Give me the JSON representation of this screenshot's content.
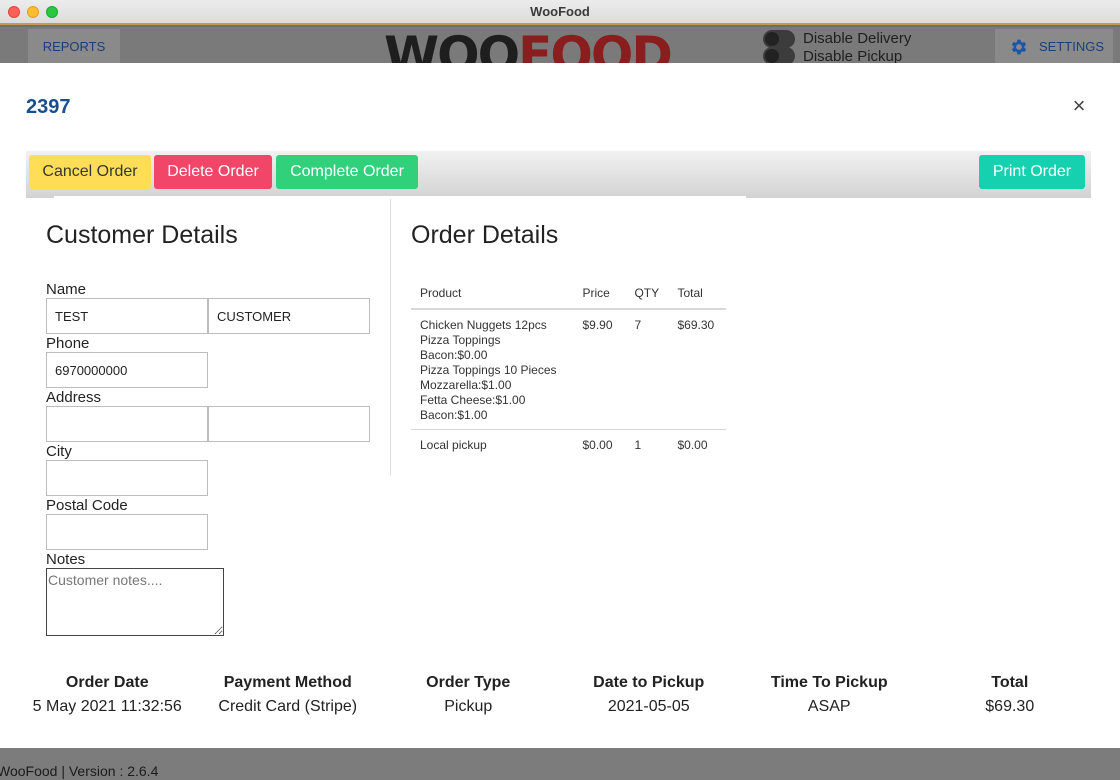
{
  "window": {
    "title": "WooFood"
  },
  "header": {
    "reports_label": "REPORTS",
    "brand_part1": "WOO",
    "brand_part2": "FOOD",
    "toggle_delivery_label": "Disable Delivery",
    "toggle_pickup_label": "Disable Pickup",
    "settings_label": "SETTINGS"
  },
  "modal": {
    "order_id": "2397",
    "close_icon": "×",
    "actions": {
      "cancel": "Cancel Order",
      "delete": "Delete Order",
      "complete": "Complete Order",
      "print": "Print Order"
    },
    "customer": {
      "title": "Customer Details",
      "name_label": "Name",
      "first_name": "TEST",
      "last_name": "CUSTOMER",
      "phone_label": "Phone",
      "phone": "6970000000",
      "address_label": "Address",
      "address_1": "",
      "address_2": "",
      "city_label": "City",
      "city": "",
      "postal_label": "Postal Code",
      "postal": "",
      "notes_label": "Notes",
      "notes_placeholder": "Customer notes...."
    },
    "order": {
      "title": "Order Details",
      "columns": [
        "Product",
        "Price",
        "QTY",
        "Total"
      ],
      "rows": [
        {
          "product_lines": [
            "Chicken Nuggets 12pcs",
            "Pizza Toppings",
            "Bacon:$0.00",
            "Pizza Toppings 10 Pieces",
            "Mozzarella:$1.00",
            "Fetta Cheese:$1.00",
            "Bacon:$1.00"
          ],
          "price": "$9.90",
          "qty": "7",
          "total": "$69.30"
        },
        {
          "product_lines": [
            "Local pickup"
          ],
          "price": "$0.00",
          "qty": "1",
          "total": "$0.00"
        }
      ]
    },
    "summary": [
      {
        "label": "Order Date",
        "value": "5 May 2021 11:32:56"
      },
      {
        "label": "Payment Method",
        "value": "Credit Card (Stripe)"
      },
      {
        "label": "Order Type",
        "value": "Pickup"
      },
      {
        "label": "Date to Pickup",
        "value": "2021-05-05"
      },
      {
        "label": "Time To Pickup",
        "value": "ASAP"
      },
      {
        "label": "Total",
        "value": "$69.30"
      }
    ]
  },
  "statusbar": {
    "version_text": "WooFood | Version : 2.6.4"
  },
  "colors": {
    "accent": "#1a4f8b",
    "cancel": "#ffdd57",
    "delete": "#f14668",
    "complete": "#31d07a",
    "print": "#16d1b0"
  }
}
